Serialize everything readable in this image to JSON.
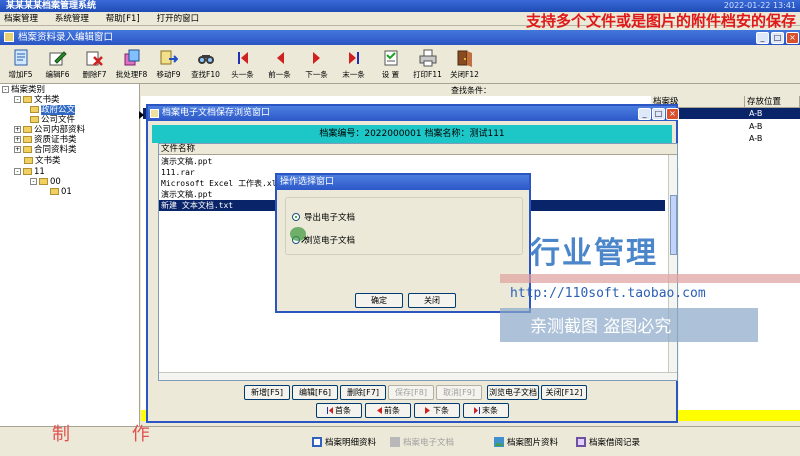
{
  "app": {
    "title": "某某某某档案管理系统",
    "clock": "2022-01-22 13:41",
    "banner": "支持多个文件或是图片的附件档安的保存"
  },
  "menu": [
    "档案管理",
    "系统管理",
    "帮助[F1]",
    "打开的窗口"
  ],
  "mdi_window": {
    "title": "档案资料录入编辑窗口"
  },
  "toolbar": [
    {
      "label": "增加F5",
      "icon": "add-doc-icon"
    },
    {
      "label": "编辑F6",
      "icon": "edit-icon"
    },
    {
      "label": "删除F7",
      "icon": "delete-icon"
    },
    {
      "label": "批处理F8",
      "icon": "batch-icon"
    },
    {
      "label": "移动F9",
      "icon": "move-icon"
    },
    {
      "label": "查找F10",
      "icon": "find-icon"
    },
    {
      "label": "头一条",
      "icon": "first-icon"
    },
    {
      "label": "前一条",
      "icon": "prev-icon"
    },
    {
      "label": "下一条",
      "icon": "next-icon"
    },
    {
      "label": "末一条",
      "icon": "last-icon"
    },
    {
      "label": "设 置",
      "icon": "settings-icon"
    },
    {
      "label": "打印F11",
      "icon": "print-icon"
    },
    {
      "label": "关闭F12",
      "icon": "close-window-icon"
    }
  ],
  "tree": {
    "root": "档案类别",
    "nodes": [
      {
        "label": "文书类"
      },
      {
        "label": "政府公文"
      },
      {
        "label": "公司文件"
      },
      {
        "label": "公司内部资料"
      },
      {
        "label": "资质证书类"
      },
      {
        "label": "合同资料类"
      },
      {
        "label": "文书类"
      },
      {
        "label": "11"
      },
      {
        "label": "00"
      },
      {
        "label": "01"
      }
    ]
  },
  "grid": {
    "find_label": "查找条件：",
    "columns": [
      "档案级",
      "存放位置"
    ],
    "location_values": [
      "A-B",
      "A-B",
      "A-B"
    ]
  },
  "file_dialog": {
    "title": "档案电子文档保存浏览窗口",
    "info_label": "档案编号：2022000001  档案名称：测试111",
    "list_header": "文件名称",
    "files": [
      "演示文稿.ppt",
      "111.rar",
      "Microsoft Excel 工作表.xlsx",
      "演示文稿.ppt",
      "新建 文本文档.txt"
    ],
    "buttons": {
      "add": "新增[F5]",
      "edit": "编辑[F6]",
      "delete": "删除[F7]",
      "save": "保存[F8]",
      "cancel": "取消[F9]",
      "browse": "浏览电子文档",
      "close": "关闭[F12]",
      "first": "首条",
      "prev": "前条",
      "next": "下条",
      "last": "末条"
    }
  },
  "op_dialog": {
    "title": "操作选择窗口",
    "option_export": "导出电子文档",
    "option_browse": "浏览电子文档",
    "ok": "确定",
    "close": "关闭"
  },
  "bottom_bar": {
    "make": "制 作",
    "btn1": "档案明细资料",
    "btn2": "档案电子文档",
    "btn3": "档案图片资料",
    "btn4": "档案借阅记录"
  },
  "watermark": {
    "big": "行业管理",
    "url": "http://110soft.taobao.com",
    "notice": "亲测截图 盗图必究"
  }
}
